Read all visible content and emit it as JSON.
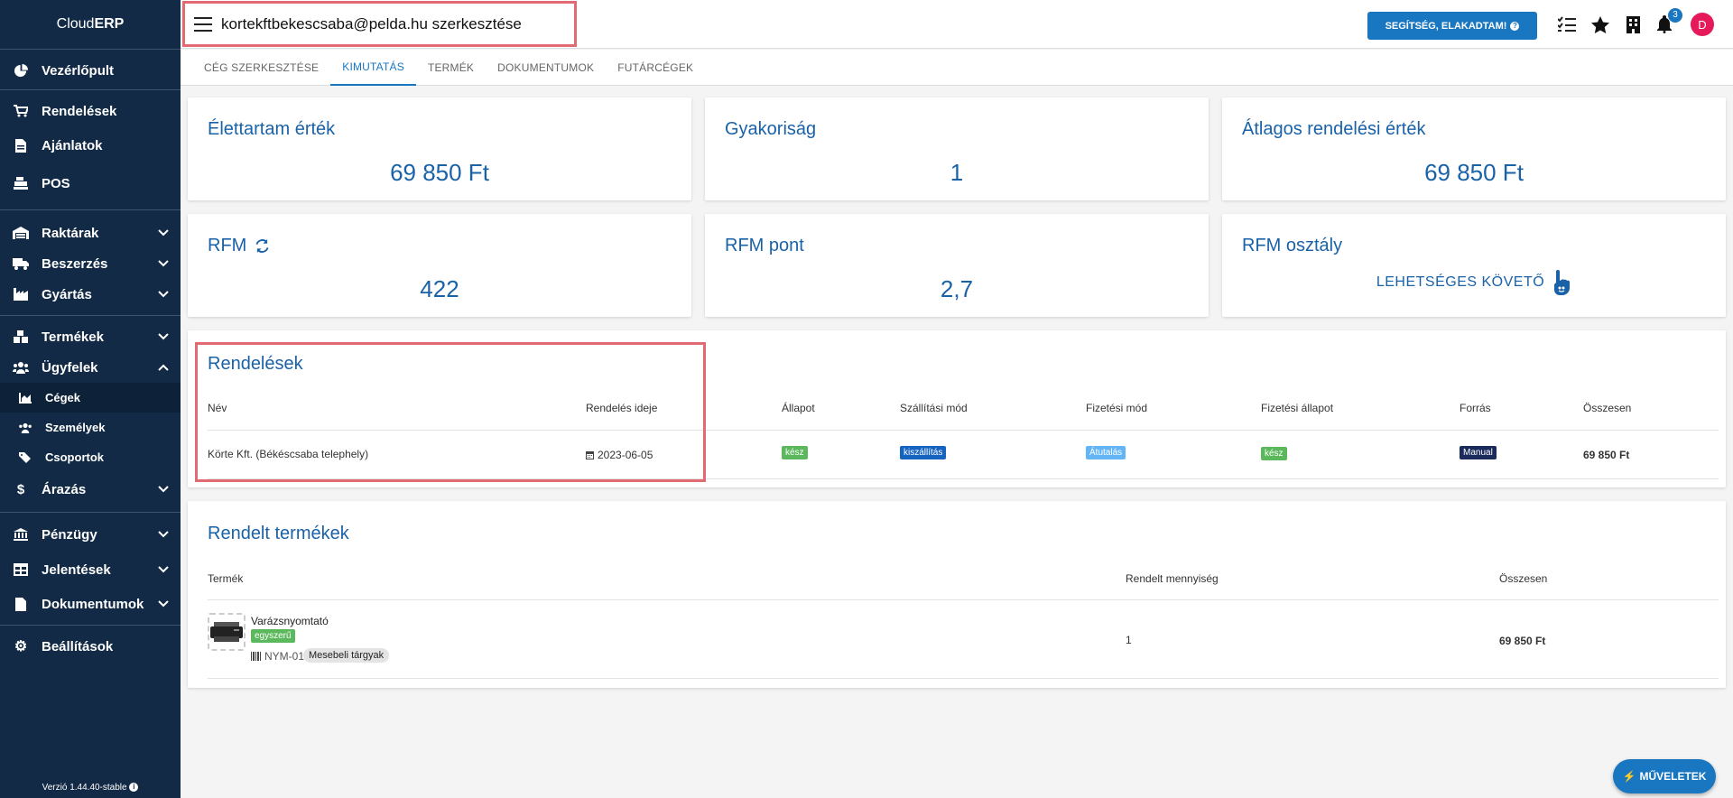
{
  "sidebar": {
    "brand_light": "Cloud",
    "brand_bold": "ERP",
    "items": [
      {
        "label": "Vezérlőpult"
      },
      {
        "label": "Rendelések"
      },
      {
        "label": "Ajánlatok"
      },
      {
        "label": "POS"
      },
      {
        "label": "Raktárak"
      },
      {
        "label": "Beszerzés"
      },
      {
        "label": "Gyártás"
      },
      {
        "label": "Termékek"
      },
      {
        "label": "Ügyfelek"
      },
      {
        "label": "Árazás"
      },
      {
        "label": "Pénzügy"
      },
      {
        "label": "Jelentések"
      },
      {
        "label": "Dokumentumok"
      },
      {
        "label": "Beállítások"
      }
    ],
    "sub_items": [
      {
        "label": "Cégek"
      },
      {
        "label": "Személyek"
      },
      {
        "label": "Csoportok"
      }
    ],
    "version": "Verzió 1.44.40-stable"
  },
  "topbar": {
    "title": "kortekftbekescsaba@pelda.hu szerkesztése",
    "help_label": "SEGÍTSÉG, ELAKADTAM!",
    "notification_count": "3",
    "avatar_initial": "D"
  },
  "tabs": [
    {
      "label": "CÉG SZERKESZTÉSE"
    },
    {
      "label": "KIMUTATÁS"
    },
    {
      "label": "TERMÉK"
    },
    {
      "label": "DOKUMENTUMOK"
    },
    {
      "label": "FUTÁRCÉGEK"
    }
  ],
  "stats": [
    {
      "title": "Élettartam érték",
      "value": "69 850 Ft"
    },
    {
      "title": "Gyakoriság",
      "value": "1"
    },
    {
      "title": "Átlagos rendelési érték",
      "value": "69 850 Ft"
    },
    {
      "title": "RFM",
      "value": "422"
    },
    {
      "title": "RFM pont",
      "value": "2,7"
    },
    {
      "title": "RFM osztály",
      "value": "LEHETSÉGES KÖVETŐ"
    }
  ],
  "orders": {
    "title": "Rendelések",
    "columns": [
      "Név",
      "Rendelés ideje",
      "Állapot",
      "Szállítási mód",
      "Fizetési mód",
      "Fizetési állapot",
      "Forrás",
      "Összesen"
    ],
    "row": {
      "name": "Körte Kft. (Békéscsaba telephely)",
      "date": "2023-06-05",
      "status": "kész",
      "shipping": "kiszállítás",
      "payment": "Átutalás",
      "payment_status": "kész",
      "source": "Manual",
      "total": "69 850 Ft"
    }
  },
  "products": {
    "title": "Rendelt termékek",
    "columns": [
      "Termék",
      "Rendelt mennyiség",
      "Összesen"
    ],
    "row": {
      "name": "Varázsnyomtató",
      "type_tag": "egyszerű",
      "sku": "NYM-01",
      "category": "Mesebeli tárgyak",
      "quantity": "1",
      "total": "69 850 Ft"
    }
  },
  "fab_label": "MŰVELETEK",
  "colors": {
    "sidebar_bg": "#122a45",
    "accent": "#1976c0",
    "highlight": "#e26a72",
    "chip_green": "#5cb85c",
    "chip_blue": "#1565c0",
    "chip_lightblue": "#64b5f6",
    "chip_navy": "#1a2a5a"
  }
}
